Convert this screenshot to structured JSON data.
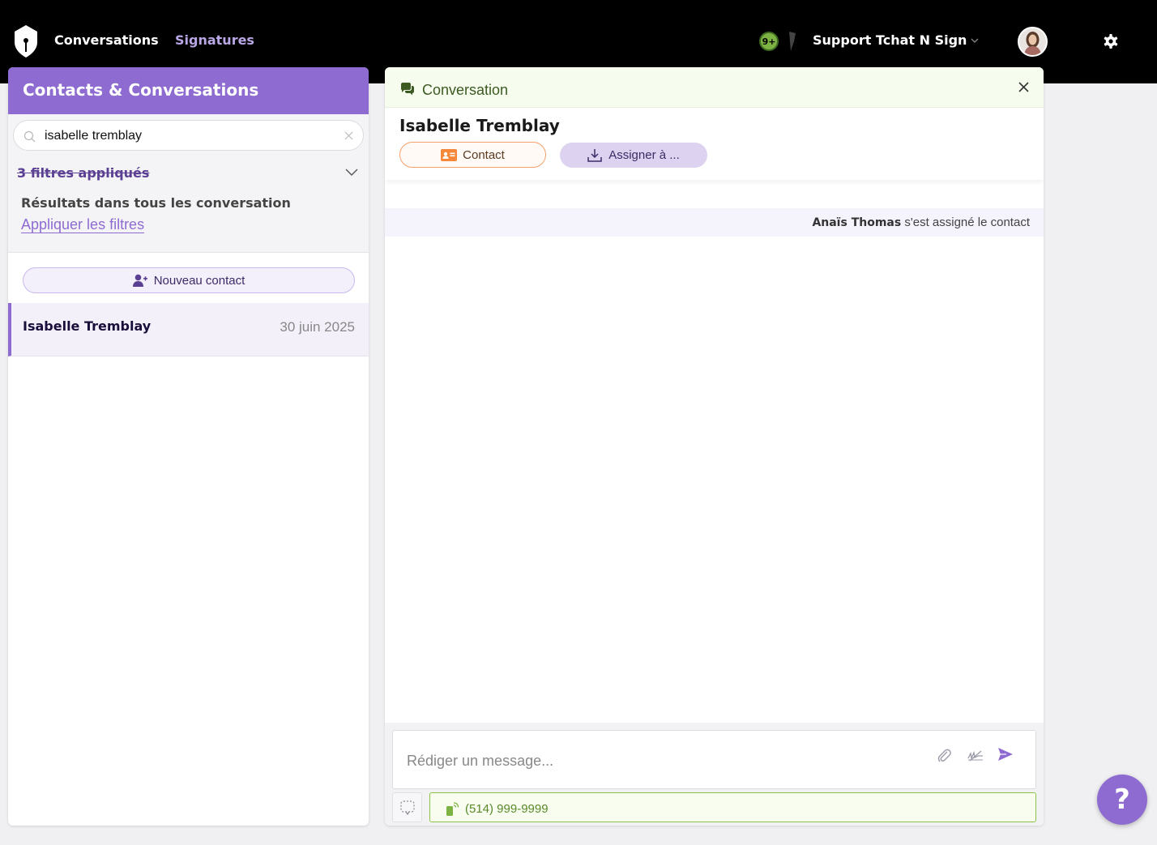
{
  "topbar": {
    "nav": [
      {
        "label": "Conversations"
      },
      {
        "label": "Signatures"
      }
    ],
    "notifications_badge": "9+",
    "account_name": "Support Tchat N Sign"
  },
  "left": {
    "title": "Contacts & Conversations",
    "search": {
      "value": "isabelle tremblay",
      "placeholder": ""
    },
    "filters_applied": "3 filtres appliqués",
    "results_label": "Résultats dans tous les conversation",
    "apply_filters": "Appliquer les filtres",
    "new_contact": "Nouveau contact",
    "conversations": [
      {
        "name": "Isabelle Tremblay",
        "date": "30 juin 2025"
      }
    ]
  },
  "right": {
    "header_label": "Conversation",
    "contact_name": "Isabelle Tremblay",
    "contact_button": "Contact",
    "assign_button": "Assigner à ...",
    "system_message": {
      "actor": "Anaïs Thomas",
      "text": "s'est assigné le contact"
    },
    "composer_placeholder": "Rédiger un message...",
    "phone": "(514) 999-9999"
  },
  "help_label": "?",
  "colors": {
    "accent": "#8e6bd0",
    "topbar": "#000000",
    "green": "#8bc34a",
    "orange": "#f5a06b"
  }
}
